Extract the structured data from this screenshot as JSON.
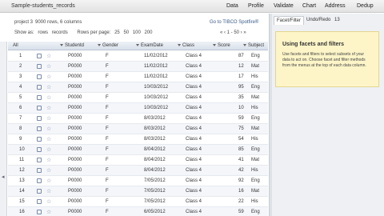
{
  "app_title": "Sample-students_records",
  "menu": [
    "Data",
    "Profile",
    "Validate",
    "Chart",
    "Address",
    "Dedup"
  ],
  "project": {
    "label": "project 3",
    "rows_info": "9000 rows, 6 columns",
    "spotfire_link": "Go to TIBCO Spotfire®",
    "show_as": "Show as:",
    "show_rows": "rows",
    "show_records": "records",
    "rows_per_page": "Rows per page:",
    "page_sizes": [
      "25",
      "50",
      "100",
      "200"
    ],
    "pager": "« ‹ 1 - 50 › »"
  },
  "table": {
    "all_label": "All",
    "columns": [
      "Studentd",
      "Gender",
      "ExamDate",
      "Class",
      "Score",
      "Subject"
    ],
    "rows": [
      {
        "n": "1",
        "id": "P0000",
        "g": "F",
        "date": "11/02/2012",
        "cls": "Class 4",
        "score": "87",
        "subj": "Eng"
      },
      {
        "n": "2",
        "id": "P0000",
        "g": "F",
        "date": "11/02/2012",
        "cls": "Class 4",
        "score": "12",
        "subj": "Mat"
      },
      {
        "n": "3",
        "id": "P0000",
        "g": "F",
        "date": "11/02/2012",
        "cls": "Class 4",
        "score": "17",
        "subj": "His"
      },
      {
        "n": "4",
        "id": "P0000",
        "g": "F",
        "date": "10/03/2012",
        "cls": "Class 4",
        "score": "95",
        "subj": "Eng"
      },
      {
        "n": "5",
        "id": "P0000",
        "g": "F",
        "date": "10/03/2012",
        "cls": "Class 4",
        "score": "35",
        "subj": "Mat"
      },
      {
        "n": "6",
        "id": "P0000",
        "g": "F",
        "date": "10/03/2012",
        "cls": "Class 4",
        "score": "10",
        "subj": "His"
      },
      {
        "n": "7",
        "id": "P0000",
        "g": "F",
        "date": "8/03/2012",
        "cls": "Class 4",
        "score": "59",
        "subj": "Eng"
      },
      {
        "n": "8",
        "id": "P0000",
        "g": "F",
        "date": "8/03/2012",
        "cls": "Class 4",
        "score": "75",
        "subj": "Mat"
      },
      {
        "n": "9",
        "id": "P0000",
        "g": "F",
        "date": "8/03/2012",
        "cls": "Class 4",
        "score": "54",
        "subj": "His"
      },
      {
        "n": "10",
        "id": "P0000",
        "g": "F",
        "date": "8/04/2012",
        "cls": "Class 4",
        "score": "85",
        "subj": "Eng"
      },
      {
        "n": "11",
        "id": "P0000",
        "g": "F",
        "date": "8/04/2012",
        "cls": "Class 4",
        "score": "41",
        "subj": "Mat"
      },
      {
        "n": "12",
        "id": "P0000",
        "g": "F",
        "date": "8/04/2012",
        "cls": "Class 4",
        "score": "42",
        "subj": "His"
      },
      {
        "n": "13",
        "id": "P0000",
        "g": "F",
        "date": "7/05/2012",
        "cls": "Class 4",
        "score": "92",
        "subj": "Eng"
      },
      {
        "n": "14",
        "id": "P0000",
        "g": "F",
        "date": "7/05/2012",
        "cls": "Class 4",
        "score": "16",
        "subj": "Mat"
      },
      {
        "n": "15",
        "id": "P0000",
        "g": "F",
        "date": "7/05/2012",
        "cls": "Class 4",
        "score": "22",
        "subj": "His"
      },
      {
        "n": "16",
        "id": "P0000",
        "g": "F",
        "date": "6/05/2012",
        "cls": "Class 4",
        "score": "59",
        "subj": "Eng"
      }
    ]
  },
  "panel": {
    "tabs": [
      "Facet/Filter",
      "Undo/Redo",
      "13"
    ],
    "info_title": "Using facets and filters",
    "info_body": "Use facets and filters to select subsets of your data to act on. Choose facet and filter methods from the menus at the top of each data column."
  }
}
